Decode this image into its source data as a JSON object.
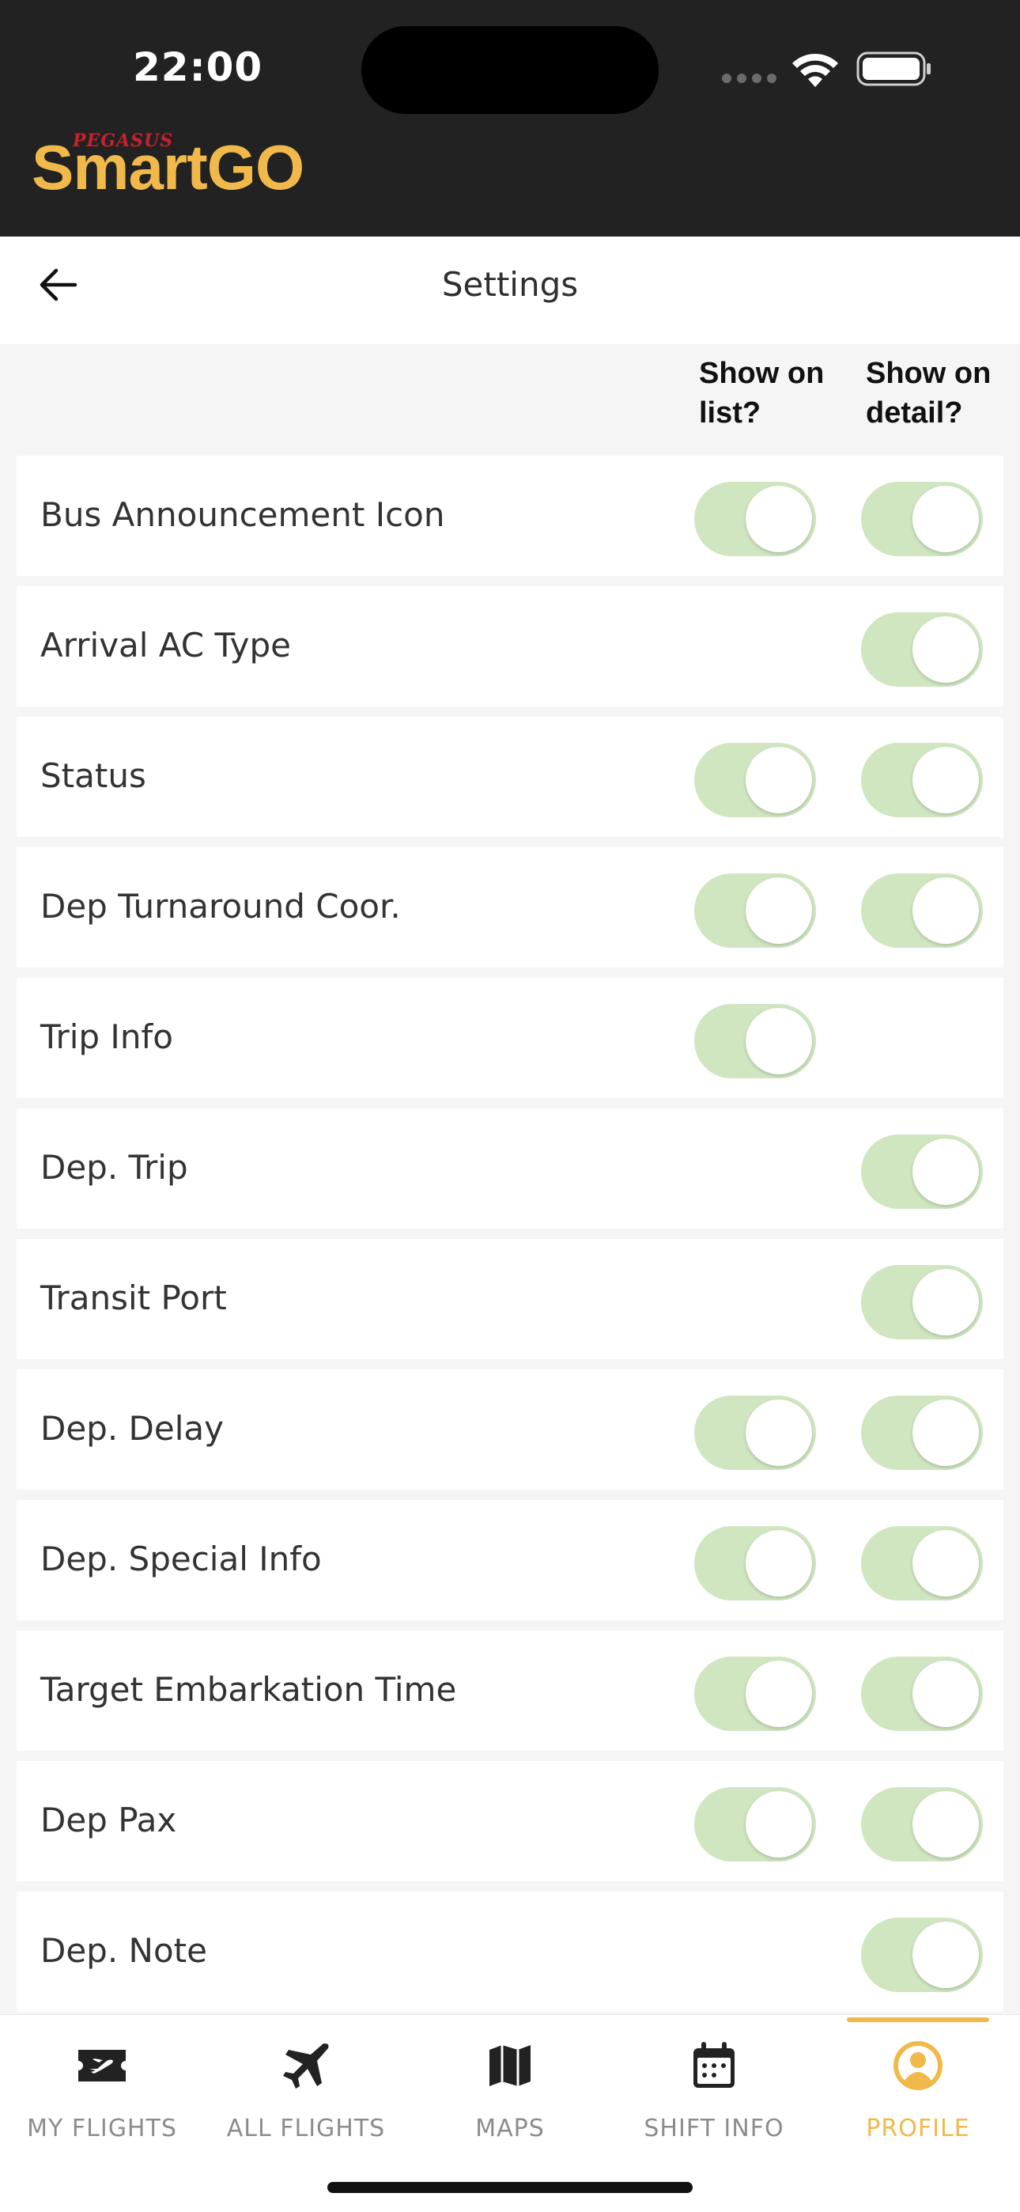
{
  "status_bar": {
    "time": "22:00"
  },
  "brand": {
    "top_word": "PEGASUS",
    "main_word": "SmartGO"
  },
  "navbar": {
    "title": "Settings"
  },
  "columns": {
    "list": "Show on list?",
    "detail": "Show on detail?"
  },
  "rows": [
    {
      "label": "Bus Announcement Icon",
      "list": true,
      "detail": true
    },
    {
      "label": "Arrival AC Type",
      "list": null,
      "detail": true
    },
    {
      "label": "Status",
      "list": true,
      "detail": true
    },
    {
      "label": "Dep Turnaround Coor.",
      "list": true,
      "detail": true
    },
    {
      "label": "Trip Info",
      "list": true,
      "detail": null
    },
    {
      "label": "Dep. Trip",
      "list": null,
      "detail": true
    },
    {
      "label": "Transit Port",
      "list": null,
      "detail": true
    },
    {
      "label": "Dep. Delay",
      "list": true,
      "detail": true
    },
    {
      "label": "Dep. Special Info",
      "list": true,
      "detail": true
    },
    {
      "label": "Target Embarkation Time",
      "list": true,
      "detail": true
    },
    {
      "label": "Dep Pax",
      "list": true,
      "detail": true
    },
    {
      "label": "Dep. Note",
      "list": null,
      "detail": true
    }
  ],
  "tabs": [
    {
      "label": "MY FLIGHTS",
      "icon": "ticket-plane-icon",
      "active": false
    },
    {
      "label": "ALL FLIGHTS",
      "icon": "airplane-icon",
      "active": false
    },
    {
      "label": "MAPS",
      "icon": "map-icon",
      "active": false
    },
    {
      "label": "SHIFT INFO",
      "icon": "calendar-icon",
      "active": false
    },
    {
      "label": "PROFILE",
      "icon": "profile-icon",
      "active": true
    }
  ],
  "colors": {
    "accent": "#f0b94a",
    "toggle_on": "#cfe6c0",
    "header_bg": "#222222",
    "brand_red": "#c8202c"
  }
}
